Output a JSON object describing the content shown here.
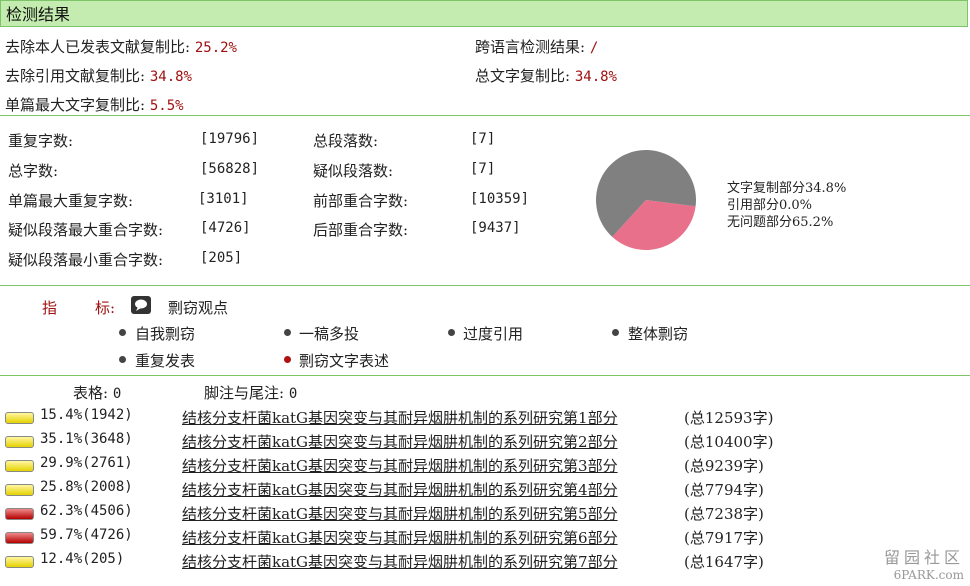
{
  "header": {
    "title": "检测结果"
  },
  "summary": {
    "exclude_self_label": "去除本人已发表文献复制比:",
    "exclude_self_value": "25.2%",
    "cross_lang_label": "跨语言检测结果:",
    "cross_lang_value": "/",
    "exclude_cite_label": "去除引用文献复制比:",
    "exclude_cite_value": "34.8%",
    "total_copy_label": "总文字复制比:",
    "total_copy_value": "34.8%",
    "single_max_label": "单篇最大文字复制比:",
    "single_max_value": "5.5%"
  },
  "stats": {
    "dup_chars_label": "重复字数:",
    "dup_chars_value": "[19796]",
    "total_paras_label": "总段落数:",
    "total_paras_value": "[7]",
    "total_chars_label": "总字数:",
    "total_chars_value": "[56828]",
    "susp_paras_label": "疑似段落数:",
    "susp_paras_value": "[7]",
    "single_max_dup_label": "单篇最大重复字数:",
    "single_max_dup_value": "[3101]",
    "front_overlap_label": "前部重合字数:",
    "front_overlap_value": "[10359]",
    "susp_max_overlap_label": "疑似段落最大重合字数:",
    "susp_max_overlap_value": "[4726]",
    "back_overlap_label": "后部重合字数:",
    "back_overlap_value": "[9437]",
    "susp_min_overlap_label": "疑似段落最小重合字数:",
    "susp_min_overlap_value": "[205]"
  },
  "chart_data": {
    "type": "pie",
    "slices": [
      {
        "label": "文字复制部分34.8%",
        "value": 34.8,
        "color": "#e8708a"
      },
      {
        "label": "引用部分0.0%",
        "value": 0.0,
        "color": "#4a8ad0"
      },
      {
        "label": "无问题部分65.2%",
        "value": 65.2,
        "color": "#808080"
      }
    ]
  },
  "indicators": {
    "label_zhi": "指",
    "label_biao": "标:",
    "title": "剽窃观点",
    "icon": "speech-bubble-icon",
    "items": [
      "自我剽窃",
      "一稿多投",
      "过度引用",
      "整体剽窃",
      "重复发表",
      "剽窃文字表述"
    ]
  },
  "tables": {
    "tables_label": "表格:",
    "tables_value": "0",
    "notes_label": "脚注与尾注:",
    "notes_value": "0"
  },
  "documents": [
    {
      "pct": "15.4%(1942)",
      "title": "结核分支杆菌katG基因突变与其耐异烟肼机制的系列研究第1部分",
      "total": "(总12593字)",
      "level": "yellow"
    },
    {
      "pct": "35.1%(3648)",
      "title": "结核分支杆菌katG基因突变与其耐异烟肼机制的系列研究第2部分",
      "total": "(总10400字)",
      "level": "yellow"
    },
    {
      "pct": "29.9%(2761)",
      "title": "结核分支杆菌katG基因突变与其耐异烟肼机制的系列研究第3部分",
      "total": "(总9239字)",
      "level": "yellow"
    },
    {
      "pct": "25.8%(2008)",
      "title": "结核分支杆菌katG基因突变与其耐异烟肼机制的系列研究第4部分",
      "total": "(总7794字)",
      "level": "yellow"
    },
    {
      "pct": "62.3%(4506)",
      "title": "结核分支杆菌katG基因突变与其耐异烟肼机制的系列研究第5部分",
      "total": "(总7238字)",
      "level": "red"
    },
    {
      "pct": "59.7%(4726)",
      "title": "结核分支杆菌katG基因突变与其耐异烟肼机制的系列研究第6部分",
      "total": "(总7917字)",
      "level": "red"
    },
    {
      "pct": "12.4%(205)",
      "title": "结核分支杆菌katG基因突变与其耐异烟肼机制的系列研究第7部分",
      "total": "(总1647字)",
      "level": "yellow"
    }
  ],
  "watermark": {
    "line1": "留园社区",
    "line2": "6PARK.com"
  }
}
